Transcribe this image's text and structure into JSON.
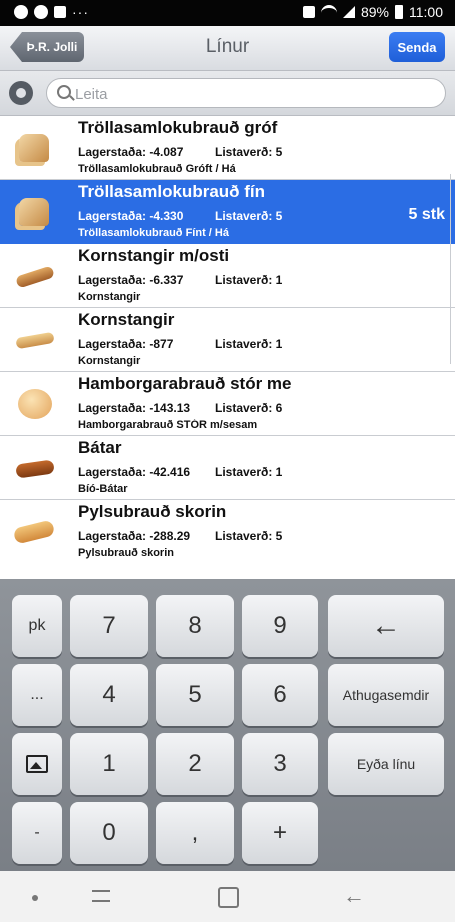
{
  "status_bar": {
    "battery": "89%",
    "time": "11:00",
    "dots": "···"
  },
  "nav": {
    "back_label": "Þ.R. Jolli",
    "title": "Línur",
    "send_label": "Senda"
  },
  "search": {
    "placeholder": "Leita",
    "icon": "search-icon",
    "settings_icon": "gear-icon"
  },
  "items": [
    {
      "name": "Tröllasamlokubrauð gróf",
      "stock": "Lagerstaða: -4.087",
      "price": "Listaverð: 5",
      "desc": "Tröllasamlokubrauð Gróft / Há",
      "image": "toast-bread",
      "selected": false,
      "qty": ""
    },
    {
      "name": "Tröllasamlokubrauð fín",
      "stock": "Lagerstaða: -4.330",
      "price": "Listaverð: 5",
      "desc": "Tröllasamlokubrauð Fínt / Há",
      "image": "toast-bread",
      "selected": true,
      "qty": "5 stk"
    },
    {
      "name": "Kornstangir m/osti",
      "stock": "Lagerstaða: -6.337",
      "price": "Listaverð: 1",
      "desc": "Kornstangir",
      "image": "bread-stick",
      "selected": false,
      "qty": ""
    },
    {
      "name": "Kornstangir",
      "stock": "Lagerstaða: -877",
      "price": "Listaverð: 1",
      "desc": "Kornstangir",
      "image": "bread-stick-pale",
      "selected": false,
      "qty": ""
    },
    {
      "name": "Hamborgarabrauð stór me",
      "stock": "Lagerstaða: -143.13",
      "price": "Listaverð: 6",
      "desc": "Hamborgarabrauð STÓR m/sesam",
      "image": "burger-bun",
      "selected": false,
      "qty": ""
    },
    {
      "name": "Bátar",
      "stock": "Lagerstaða: -42.416",
      "price": "Listaverð: 1",
      "desc": "Bíó-Bátar",
      "image": "boat-roll",
      "selected": false,
      "qty": ""
    },
    {
      "name": "Pylsubrauð skorin",
      "stock": "Lagerstaða: -288.29",
      "price": "Listaverð: 5",
      "desc": "Pylsubrauð skorin",
      "image": "hotdog-bun",
      "selected": false,
      "qty": ""
    }
  ],
  "keypad": {
    "pk": "pk",
    "dots": "...",
    "minus": "-",
    "k7": "7",
    "k8": "8",
    "k9": "9",
    "k4": "4",
    "k5": "5",
    "k6": "6",
    "k1": "1",
    "k2": "2",
    "k3": "3",
    "k0": "0",
    "comma": ",",
    "plus": "+",
    "backspace": "←",
    "note": "Athugasemdir",
    "delete_line": "Eyða línu"
  }
}
